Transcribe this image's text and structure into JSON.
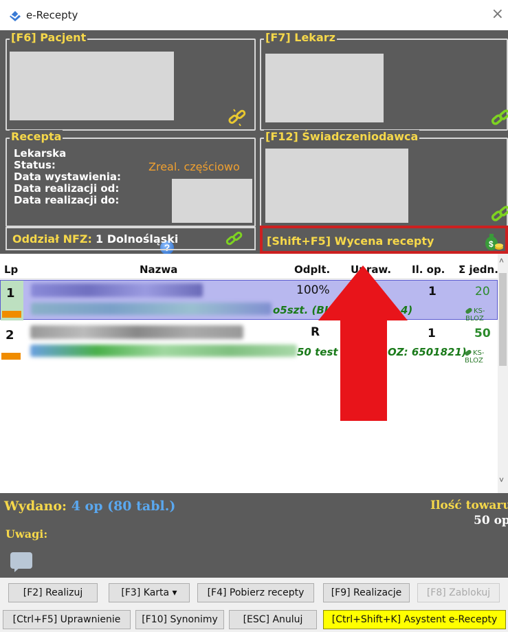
{
  "window": {
    "title": "e-Recepty",
    "close": "×"
  },
  "panels": {
    "patient": {
      "title": "[F6] Pacjent"
    },
    "doctor": {
      "title": "[F7] Lekarz"
    },
    "prescription": {
      "title": "Recepta",
      "type": "Lekarska",
      "status_label": "Status:",
      "status_value": "Zreal. częściowo",
      "issue_date_label": "Data wystawienia:",
      "realization_from_label": "Data realizacji od:",
      "realization_to_label": "Data realizacji do:",
      "help": "?"
    },
    "provider": {
      "title": "[F12] Świadczeniodawca"
    },
    "nfz": {
      "label": "Oddział NFZ:",
      "value": "1 Dolnośląski"
    },
    "pricing": {
      "title": "[Shift+F5] Wycena recepty"
    }
  },
  "table": {
    "columns": [
      "Lp",
      "Nazwa",
      "Odplt.",
      "Upraw.",
      "Il. op.",
      "Σ jedn."
    ],
    "rows": [
      {
        "lp": "1",
        "odplt": "100%",
        "il_op": "1",
        "jedn": "20",
        "sub": "o5szt. (BL",
        "sub2": "4)",
        "code": "KS-BLOZ"
      },
      {
        "lp": "2",
        "odplt": "R",
        "il_op": "1",
        "jedn": "50",
        "sub": "50 test",
        "sub2": "OZ: 6501821)",
        "code": "KS-BLOZ"
      }
    ]
  },
  "summary": {
    "issued_label": "Wydano:",
    "issued_value": "4 op (80 tabl.)",
    "qty_label": "Ilość towaru",
    "qty_value": "50 op",
    "notes_label": "Uwagi:"
  },
  "buttons": {
    "realize": "[F2] Realizuj",
    "card": "[F3] Karta ▾",
    "fetch": "[F4] Pobierz recepty",
    "realizations": "[F9] Realizacje",
    "lock": "[F8] Zablokuj",
    "entitlement": "[Ctrl+F5] Uprawnienie",
    "synonyms": "[F10] Synonimy",
    "cancel": "[ESC] Anuluj",
    "assistant": "[Ctrl+Shift+K] Asystent e-Recepty"
  },
  "colors": {
    "panel_bg": "#5b5b5b",
    "panel_title": "#f6d84a",
    "status_orange": "#f0a030",
    "highlight_border": "#cc2020",
    "selected_row": "#b8b8ef",
    "assistant_button": "#ffff00"
  }
}
